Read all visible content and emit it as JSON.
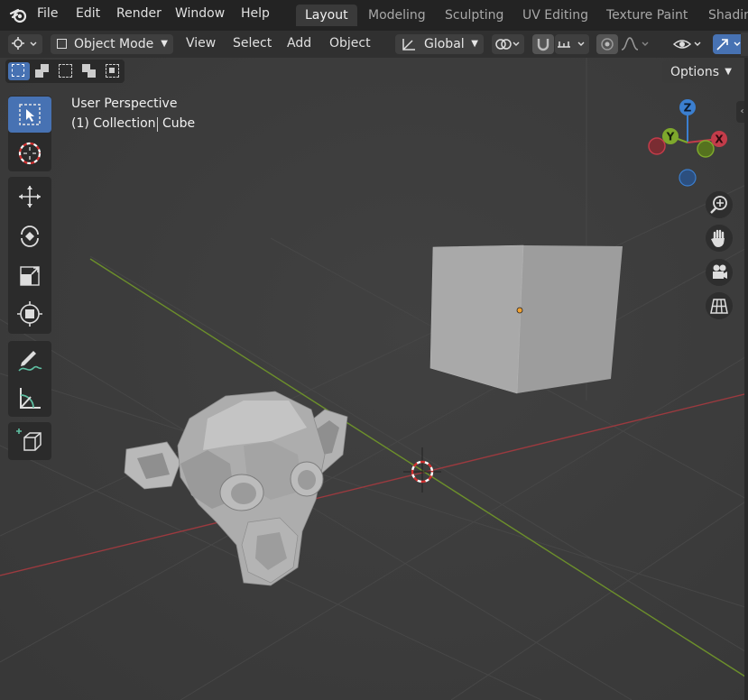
{
  "top_menu": [
    "File",
    "Edit",
    "Render",
    "Window",
    "Help"
  ],
  "workspace_tabs": [
    {
      "label": "Layout",
      "active": true
    },
    {
      "label": "Modeling",
      "active": false
    },
    {
      "label": "Sculpting",
      "active": false
    },
    {
      "label": "UV Editing",
      "active": false
    },
    {
      "label": "Texture Paint",
      "active": false
    },
    {
      "label": "Shadin",
      "active": false
    }
  ],
  "header": {
    "mode": "Object Mode",
    "menus": [
      "View",
      "Select",
      "Add",
      "Object"
    ],
    "transform_orientation": "Global",
    "options_label": "Options"
  },
  "overlay": {
    "view_name": "User Perspective",
    "collection": "(1) Collection",
    "object": "Cube"
  },
  "gizmo": {
    "z": "Z",
    "y": "Y",
    "x": "X"
  },
  "colors": {
    "accent": "#4772b3",
    "x_axis": "#c33c4a",
    "y_axis": "#7ea82c",
    "z_axis": "#3b7fd0"
  },
  "tools": [
    "select-box",
    "cursor",
    "move",
    "rotate",
    "scale",
    "transform",
    "annotate",
    "measure",
    "add-cube"
  ],
  "nav_buttons": [
    "zoom",
    "pan",
    "camera",
    "perspective-toggle"
  ]
}
